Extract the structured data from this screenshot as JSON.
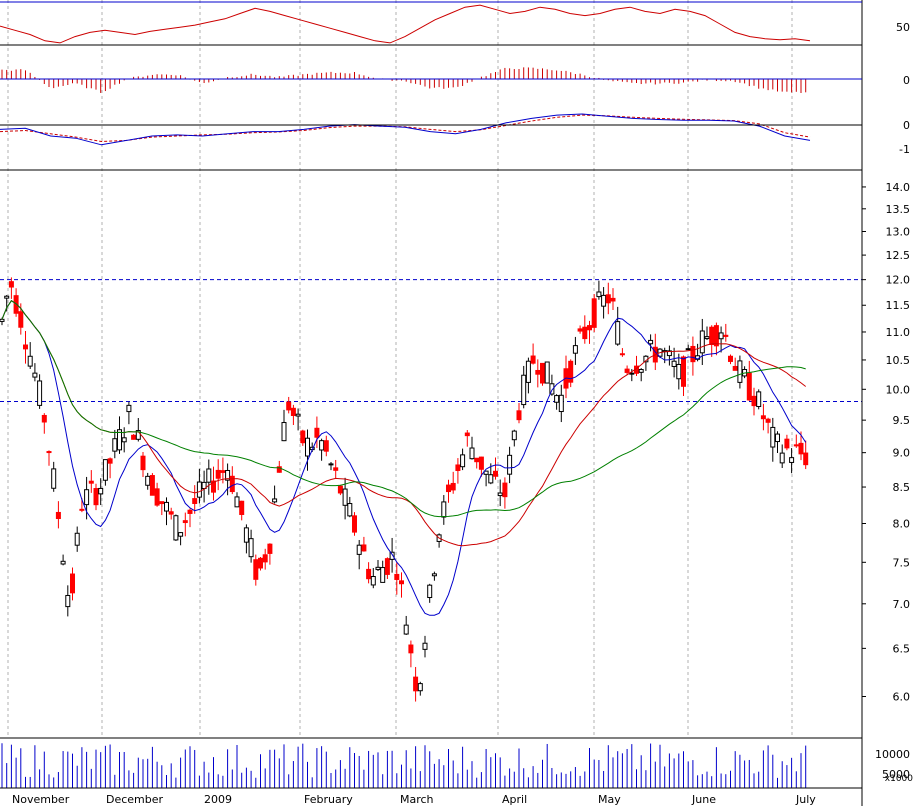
{
  "chart_data": {
    "type": "candlestick",
    "colors": {
      "up": "#000000",
      "down": "#ff0000",
      "ma_short": "#0000cc",
      "ma_mid": "#cc0000",
      "ma_long": "#008000",
      "rsi": "#cc0000",
      "macd_line": "#0000cc",
      "macd_signal": "#cc0000",
      "hist": "#cc0000",
      "volume": "#0000cc",
      "reference": "#0000cc",
      "grid": "#b0b0b0"
    },
    "x_labels": [
      "November",
      "December",
      "2009",
      "February",
      "March",
      "April",
      "May",
      "June",
      "July"
    ],
    "price_axis": {
      "scale": "log",
      "range": [
        5.6,
        14.4
      ],
      "ticks": [
        "14.0",
        "13.5",
        "13.0",
        "12.5",
        "12.0",
        "11.5",
        "11.0",
        "10.5",
        "10.0",
        "9.5",
        "9.0",
        "8.5",
        "8.0",
        "7.5",
        "7.0",
        "6.5",
        "6.0"
      ],
      "reference_levels": [
        12.0,
        9.8
      ]
    },
    "rsi_panel": {
      "ticks": [
        "50"
      ],
      "series": [
        48,
        44,
        40,
        34,
        32,
        38,
        42,
        44,
        42,
        40,
        43,
        45,
        47,
        49,
        52,
        55,
        60,
        65,
        62,
        58,
        54,
        50,
        46,
        42,
        38,
        34,
        32,
        38,
        46,
        54,
        60,
        66,
        68,
        64,
        60,
        62,
        66,
        64,
        60,
        58,
        60,
        64,
        66,
        62,
        60,
        64,
        62,
        58,
        50,
        42,
        38,
        36,
        35,
        36,
        34
      ]
    },
    "macd_panel": {
      "ticks": [
        "0",
        "-1"
      ],
      "macd": [
        -0.2,
        -0.15,
        -0.5,
        -0.6,
        -0.9,
        -0.7,
        -0.5,
        -0.45,
        -0.5,
        -0.4,
        -0.3,
        -0.3,
        -0.2,
        -0.05,
        0.02,
        -0.05,
        -0.1,
        -0.3,
        -0.4,
        -0.2,
        0.1,
        0.3,
        0.45,
        0.5,
        0.4,
        0.3,
        0.25,
        0.22,
        0.22,
        0.18,
        -0.05,
        -0.5,
        -0.7
      ],
      "signal": [
        -0.3,
        -0.25,
        -0.4,
        -0.55,
        -0.75,
        -0.7,
        -0.55,
        -0.5,
        -0.45,
        -0.42,
        -0.35,
        -0.32,
        -0.25,
        -0.12,
        -0.05,
        -0.05,
        -0.08,
        -0.2,
        -0.3,
        -0.22,
        -0.02,
        0.18,
        0.35,
        0.45,
        0.42,
        0.35,
        0.3,
        0.26,
        0.23,
        0.2,
        0.05,
        -0.35,
        -0.55
      ]
    },
    "volume_panel": {
      "ticks": [
        "10000",
        "5000"
      ],
      "unit": "x1000"
    }
  }
}
